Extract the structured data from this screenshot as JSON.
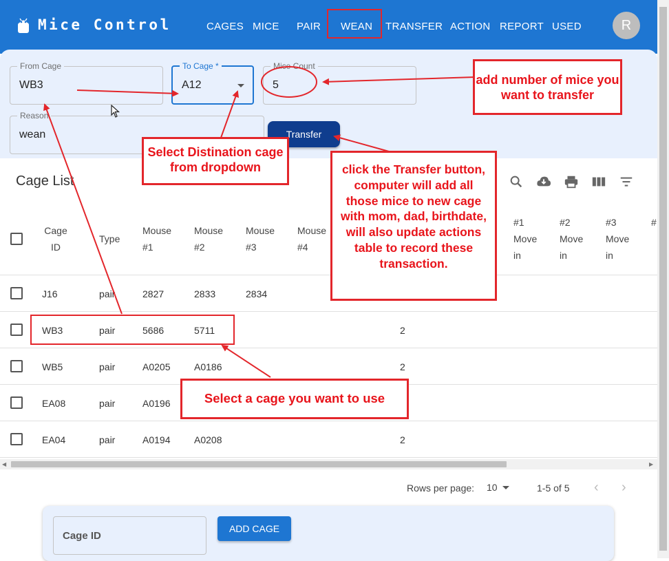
{
  "app": {
    "title": "Mice Control",
    "avatar_letter": "R"
  },
  "nav": [
    "CAGES",
    "MICE",
    "PAIR",
    "WEAN",
    "TRANSFER",
    "ACTION",
    "REPORT",
    "USED"
  ],
  "form": {
    "from_cage": {
      "label": "From Cage",
      "value": "WB3"
    },
    "to_cage": {
      "label": "To Cage *",
      "value": "A12"
    },
    "mice_count": {
      "label": "Mice Count",
      "value": "5"
    },
    "reason": {
      "label": "Reason",
      "value": "wean"
    },
    "transfer_button": "Transfer"
  },
  "table": {
    "title": "Cage List",
    "headers": [
      "Cage ID",
      "Type",
      "Mouse #1",
      "Mouse #2",
      "Mouse #3",
      "Mouse #4"
    ],
    "move_headers": [
      "#1 Move in",
      "#2 Move in",
      "#3 Move in"
    ],
    "rows": [
      {
        "cage_id": "J16",
        "type": "pair",
        "m1": "2827",
        "m2": "2833",
        "m3": "2834",
        "count": ""
      },
      {
        "cage_id": "WB3",
        "type": "pair",
        "m1": "5686",
        "m2": "5711",
        "m3": "",
        "count": "2"
      },
      {
        "cage_id": "WB5",
        "type": "pair",
        "m1": "A0205",
        "m2": "A0186",
        "m3": "",
        "count": "2"
      },
      {
        "cage_id": "EA08",
        "type": "pair",
        "m1": "A0196",
        "m2": "",
        "m3": "",
        "count": ""
      },
      {
        "cage_id": "EA04",
        "type": "pair",
        "m1": "A0194",
        "m2": "A0208",
        "m3": "",
        "count": "2"
      }
    ]
  },
  "pagination": {
    "rows_per_page_label": "Rows per page:",
    "rows_per_page": "10",
    "range": "1-5 of 5"
  },
  "add_panel": {
    "cage_id_placeholder": "Cage ID",
    "add_button": "ADD CAGE"
  },
  "annotations": {
    "mice_count": "add number of mice you want to transfer",
    "destination": "Select Distination cage from dropdown",
    "transfer": "click the Transfer button, computer will add all those mice to new cage with mom, dad, birthdate, will also update actions table to record these transaction.",
    "select_cage": "Select a cage you want to use"
  },
  "colors": {
    "primary": "#1e76d2",
    "panel": "#e8f0fd",
    "transfer_button": "#0f3d8e",
    "annotation": "#e3262b"
  },
  "icons": [
    "android-icon",
    "search-icon",
    "cloud-download-icon",
    "print-icon",
    "view-column-icon",
    "filter-icon",
    "chevron-left-icon",
    "chevron-right-icon",
    "cursor-icon"
  ]
}
